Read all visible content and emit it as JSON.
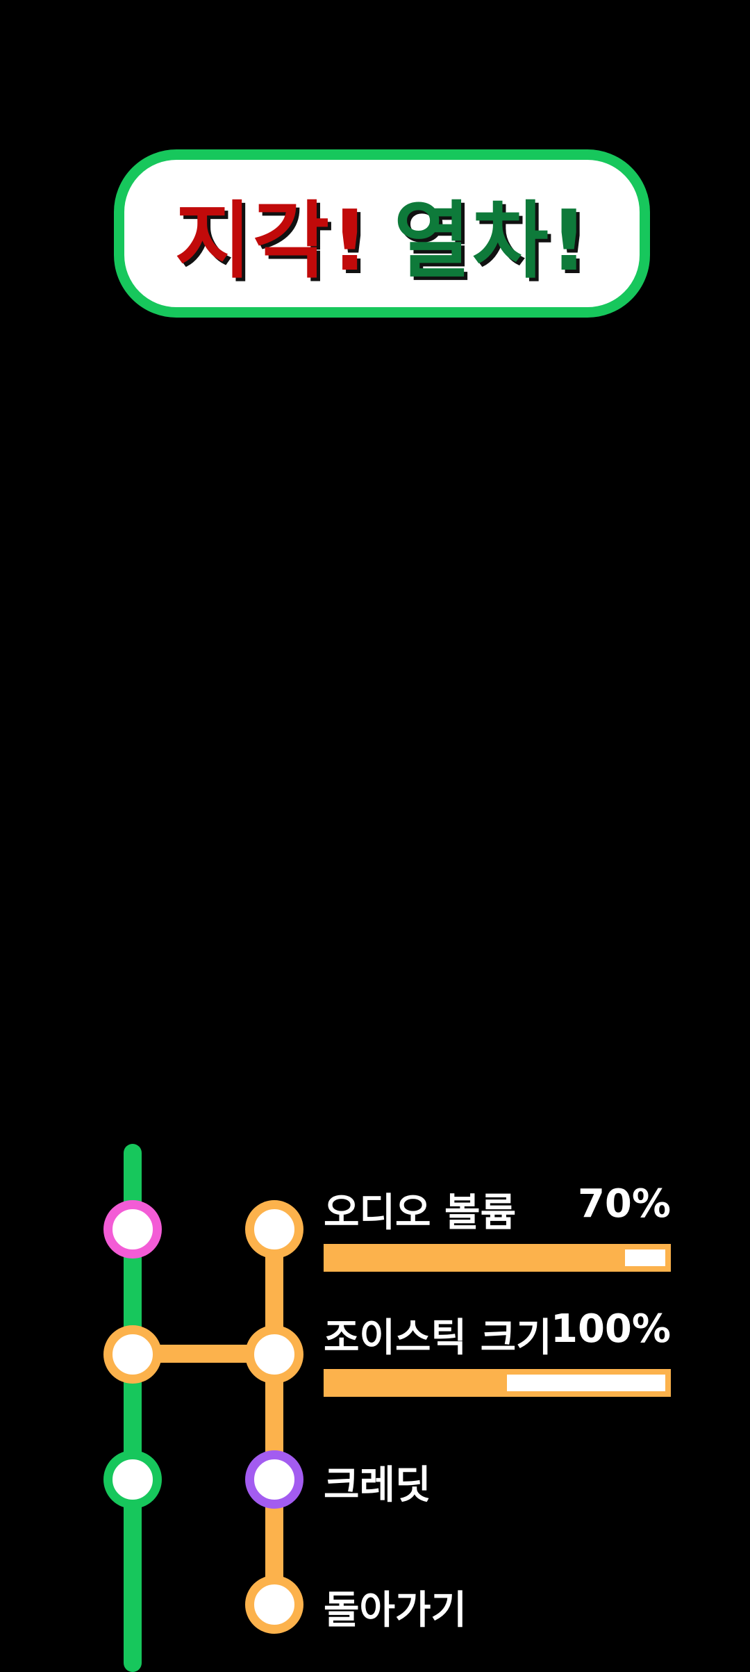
{
  "title": {
    "part1": "지각!",
    "part2": "열차!"
  },
  "menu": {
    "items": [
      {
        "label": "오디오 볼륨",
        "value": "70%",
        "level": 0.7
      },
      {
        "label": "조이스틱 크기",
        "value": "100%",
        "level": 1.0
      },
      {
        "label": "크레딧"
      },
      {
        "label": "돌아가기"
      }
    ]
  },
  "colors": {
    "green_line": "#17c75c",
    "orange_line": "#fcb24c",
    "title_red": "#c10a0a",
    "title_green": "#0e7a3a",
    "station_pink": "#f35cd6",
    "station_purple": "#a35cf0"
  }
}
